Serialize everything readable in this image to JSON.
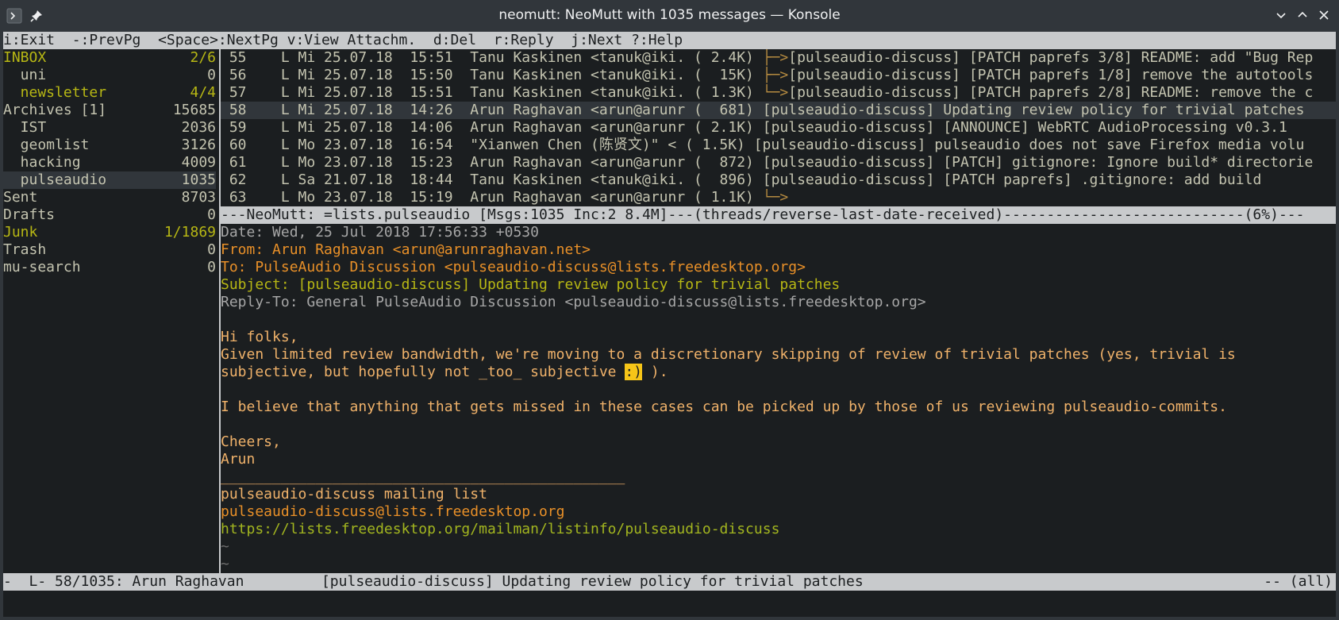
{
  "window": {
    "title": "neomutt: NeoMutt with 1035 messages — Konsole",
    "app_icon": "terminal-icon",
    "pin_icon": "pin-icon",
    "controls": [
      "minimize-icon",
      "maximize-icon",
      "close-icon"
    ]
  },
  "help_bar": "i:Exit  -:PrevPg  <Space>:NextPg v:View Attachm.  d:Del  r:Reply  j:Next ?:Help",
  "sidebar": {
    "items": [
      {
        "name": "INBOX",
        "count": "2/6"
      },
      {
        "name": "  uni",
        "count": "0"
      },
      {
        "name": "  newsletter",
        "count": "4/4"
      },
      {
        "name": "Archives [1]",
        "count": "15685"
      },
      {
        "name": "  IST",
        "count": "2036"
      },
      {
        "name": "  geomlist",
        "count": "3126"
      },
      {
        "name": "  hacking",
        "count": "4009"
      },
      {
        "name": "  pulseaudio",
        "count": "1035"
      },
      {
        "name": "Sent",
        "count": "8703"
      },
      {
        "name": "Drafts",
        "count": "0"
      },
      {
        "name": "Junk",
        "count": "1/1869"
      },
      {
        "name": "Trash",
        "count": "0"
      },
      {
        "name": "mu-search",
        "count": "0"
      }
    ]
  },
  "index": {
    "rows": [
      {
        "prefix": " 55    L Mi 25.07.18  15:51  Tanu Kaskinen <tanuk@iki. ( 2.4K) ",
        "tree": "├─>",
        "subject": "[pulseaudio-discuss] [PATCH paprefs 3/8] README: add \"Bug Rep"
      },
      {
        "prefix": " 56    L Mi 25.07.18  15:50  Tanu Kaskinen <tanuk@iki. (  15K) ",
        "tree": "├─>",
        "subject": "[pulseaudio-discuss] [PATCH paprefs 1/8] remove the autotools"
      },
      {
        "prefix": " 57    L Mi 25.07.18  15:51  Tanu Kaskinen <tanuk@iki. ( 1.3K) ",
        "tree": "└─>",
        "subject": "[pulseaudio-discuss] [PATCH paprefs 2/8] README: remove the c"
      },
      {
        "prefix": " 58    L Mi 25.07.18  14:26  Arun Raghavan <arun@arunr (  681) ",
        "tree": "",
        "subject": "[pulseaudio-discuss] Updating review policy for trivial patches"
      },
      {
        "prefix": " 59    L Mi 25.07.18  14:06  Arun Raghavan <arun@arunr ( 2.1K) ",
        "tree": "",
        "subject": "[pulseaudio-discuss] [ANNOUNCE] WebRTC AudioProcessing v0.3.1"
      },
      {
        "prefix": " 60    L Mo 23.07.18  16:54  \"Xianwen Chen (陈贤文)\" < ( 1.5K) ",
        "tree": "",
        "subject": "[pulseaudio-discuss] pulseaudio does not save Firefox media volu"
      },
      {
        "prefix": " 61    L Mo 23.07.18  15:23  Arun Raghavan <arun@arunr (  872) ",
        "tree": "",
        "subject": "[pulseaudio-discuss] [PATCH] gitignore: Ignore build* directorie"
      },
      {
        "prefix": " 62    L Sa 21.07.18  18:44  Tanu Kaskinen <tanuk@iki. (  896) ",
        "tree": "",
        "subject": "[pulseaudio-discuss] [PATCH paprefs] .gitignore: add build"
      },
      {
        "prefix": " 63    L Mo 23.07.18  15:19  Arun Raghavan <arun@arunr ( 1.1K) ",
        "tree": "└─>",
        "subject": ""
      }
    ]
  },
  "index_status": "---NeoMutt: =lists.pulseaudio [Msgs:1035 Inc:2 8.4M]---(threads/reverse-last-date-received)----------------------------(6%)---",
  "message": {
    "date": "Date: Wed, 25 Jul 2018 17:56:33 +0530",
    "from": "From: Arun Raghavan <arun@arunraghavan.net>",
    "to": "To: PulseAudio Discussion <pulseaudio-discuss@lists.freedesktop.org>",
    "subject": "Subject: [pulseaudio-discuss] Updating review policy for trivial patches",
    "reply_to": "Reply-To: General PulseAudio Discussion <pulseaudio-discuss@lists.freedesktop.org>",
    "body_greeting": "Hi folks,",
    "body_line1": "Given limited review bandwidth, we're moving to a discretionary skipping of review of trivial patches (yes, trivial is",
    "body_line2_a": "subjective, but hopefully not _too_ subjective ",
    "body_line2_smiley": ":)",
    "body_line2_b": " ).",
    "body_para2": "I believe that anything that gets missed in these cases can be picked up by those of us reviewing pulseaudio-commits.",
    "body_closing": "Cheers,",
    "body_name": "Arun",
    "sig_rule": "_______________________________________________",
    "sig_list": "pulseaudio-discuss mailing list",
    "sig_email": "pulseaudio-discuss@lists.freedesktop.org",
    "sig_url": "https://lists.freedesktop.org/mailman/listinfo/pulseaudio-discuss",
    "tilde": "~"
  },
  "pager_status": {
    "left": "-  L- 58/1035: Arun Raghavan         [pulseaudio-discuss] Updating review policy for trivial patches",
    "right": "-- (all)"
  }
}
